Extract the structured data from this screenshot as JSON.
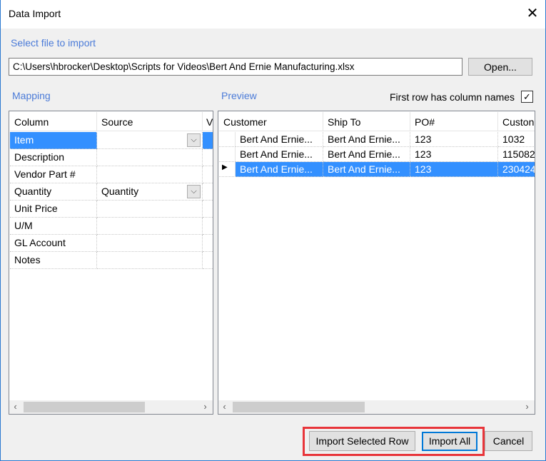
{
  "window": {
    "title": "Data Import",
    "close_icon": "close-icon"
  },
  "file": {
    "label": "Select file to import",
    "path": "C:\\Users\\hbrocker\\Desktop\\Scripts for Videos\\Bert And Ernie Manufacturing.xlsx",
    "open_label": "Open..."
  },
  "mapping": {
    "label": "Mapping",
    "headers": [
      "Column",
      "Source",
      "V"
    ],
    "rows": [
      {
        "column": "Item",
        "source": ""
      },
      {
        "column": "Description",
        "source": ""
      },
      {
        "column": "Vendor Part #",
        "source": ""
      },
      {
        "column": "Quantity",
        "source": "Quantity"
      },
      {
        "column": "Unit Price",
        "source": ""
      },
      {
        "column": "U/M",
        "source": ""
      },
      {
        "column": "GL Account",
        "source": ""
      },
      {
        "column": "Notes",
        "source": ""
      }
    ]
  },
  "preview": {
    "label": "Preview",
    "first_row_label": "First row has column names",
    "first_row_checked": true,
    "headers": [
      "Customer",
      "Ship To",
      "PO#",
      "Custon"
    ],
    "rows": [
      [
        "Bert And Ernie...",
        "Bert And Ernie...",
        "123",
        "1032"
      ],
      [
        "Bert And Ernie...",
        "Bert And Ernie...",
        "123",
        "115082"
      ],
      [
        "Bert And Ernie...",
        "Bert And Ernie...",
        "123",
        "230424"
      ]
    ],
    "selected_row": 2
  },
  "buttons": {
    "import_selected": "Import  Selected Row",
    "import_all": "Import All",
    "cancel": "Cancel"
  },
  "colors": {
    "accent": "#3390ff",
    "highlight_box": "#e8353a",
    "label": "#4b7bd8"
  }
}
